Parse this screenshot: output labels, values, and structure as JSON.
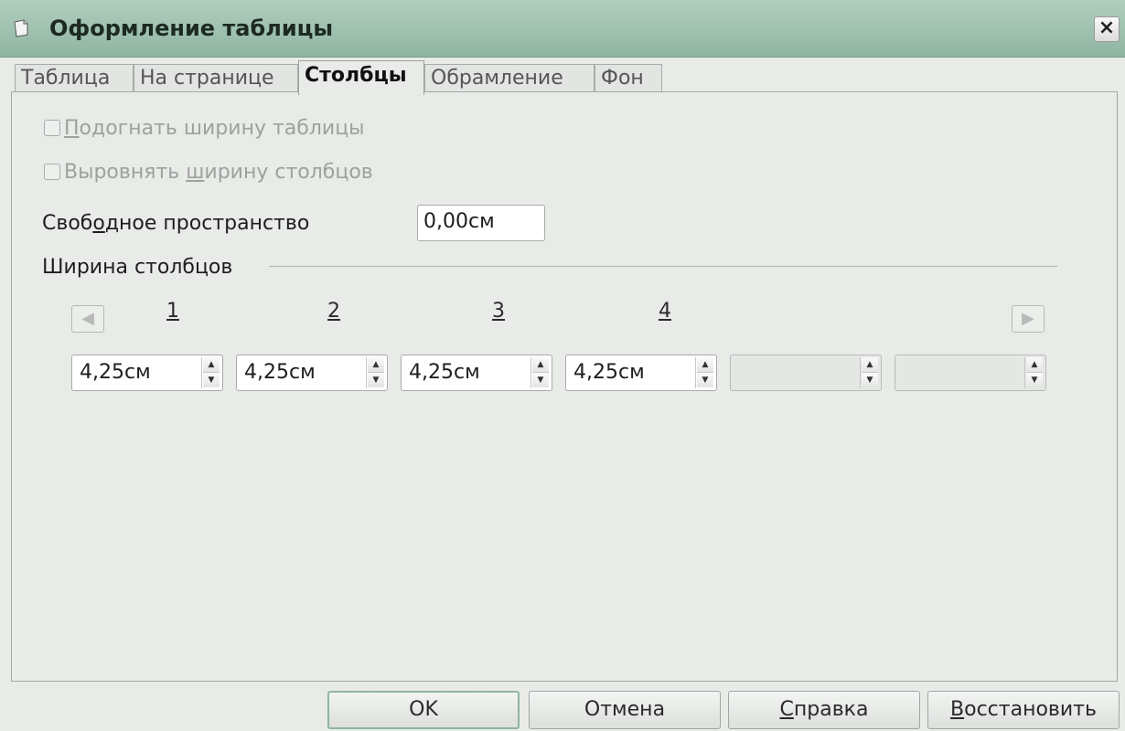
{
  "window": {
    "title": "Оформление таблицы",
    "close_glyph": "×",
    "icon": "app-document-icon"
  },
  "tabs": [
    {
      "label": "Таблица",
      "active": false
    },
    {
      "label": "На странице",
      "active": false
    },
    {
      "label": "Столбцы",
      "active": true
    },
    {
      "label": "Обрамление",
      "active": false
    },
    {
      "label": "Фон",
      "active": false
    }
  ],
  "options": {
    "fit_width": {
      "pre": "",
      "underlined": "П",
      "post": "одогнать ширину таблицы",
      "checked": false,
      "enabled": false
    },
    "equal_width": {
      "pre": "Выровнять ",
      "underlined": "ш",
      "post": "ирину столбцов",
      "checked": false,
      "enabled": false
    }
  },
  "free_space": {
    "pre": "Своб",
    "underlined": "о",
    "post": "дное пространство",
    "value": "0,00см"
  },
  "column_width": {
    "legend": "Ширина столбцов",
    "left_arrow": "◀",
    "right_arrow": "▶",
    "columns": [
      {
        "number": "1",
        "value": "4,25см"
      },
      {
        "number": "2",
        "value": "4,25см"
      },
      {
        "number": "3",
        "value": "4,25см"
      },
      {
        "number": "4",
        "value": "4,25см"
      },
      {
        "number": "",
        "value": ""
      },
      {
        "number": "",
        "value": ""
      }
    ],
    "spin_up": "▲",
    "spin_down": "▼"
  },
  "buttons": {
    "ok": {
      "label": "OK"
    },
    "cancel": {
      "label": "Отмена"
    },
    "help": {
      "underlined": "С",
      "post": "правка"
    },
    "reset": {
      "underlined": "В",
      "post": "осстановить"
    }
  },
  "colors": {
    "titlebar": "#9ec2b0",
    "panel": "#e8ebe8",
    "default_button_border": "#8fb5a2"
  }
}
